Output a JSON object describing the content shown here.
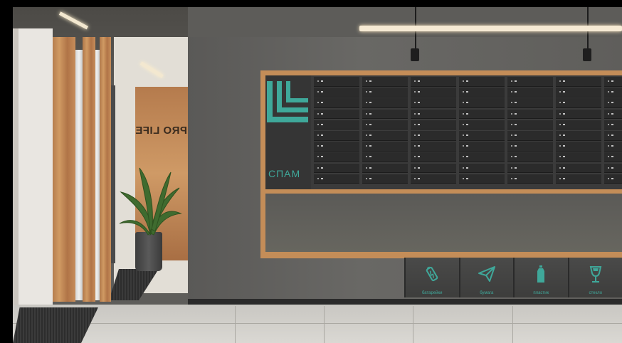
{
  "scene": {
    "type": "interior-render",
    "subject": "apartment building lobby with wall of mailboxes and recycling bins"
  },
  "wall_sign": {
    "text": "PRO LIFE"
  },
  "mailbox_panel": {
    "logo_text": "СПАМ",
    "columns": 7,
    "rows": 10,
    "accent_color": "#3fa89a"
  },
  "recycling_bins": [
    {
      "icon": "battery-icon",
      "label": "батарейки"
    },
    {
      "icon": "paper-plane-icon",
      "label": "бумага"
    },
    {
      "icon": "bottle-icon",
      "label": "пластик"
    },
    {
      "icon": "glass-icon",
      "label": "стекло"
    }
  ],
  "colors": {
    "wall": "#63625f",
    "wood": "#c48d58",
    "mailbox": "#2b2b2b",
    "accent": "#3fa89a"
  }
}
